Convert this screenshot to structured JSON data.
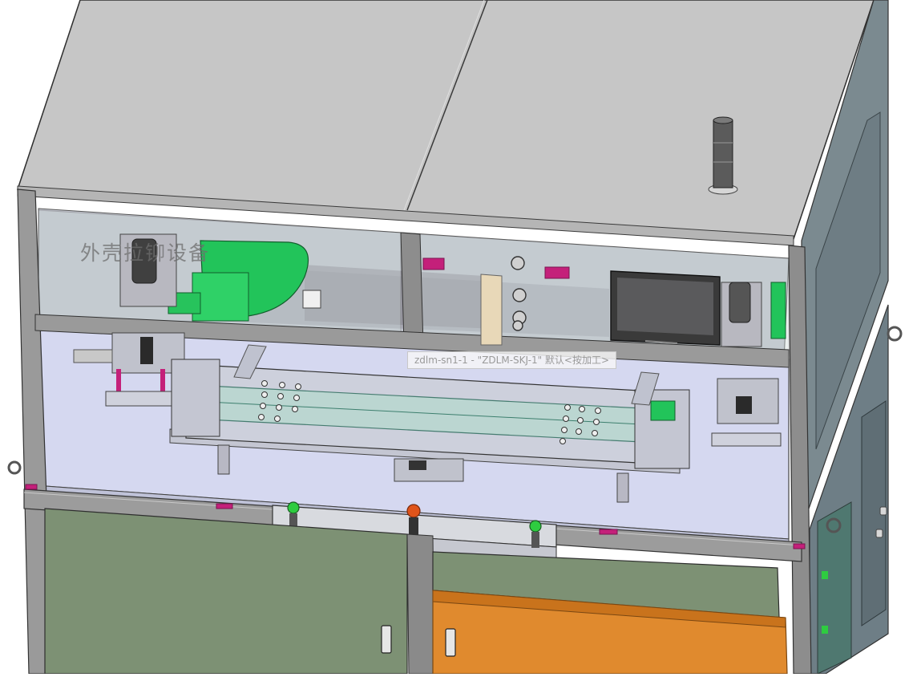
{
  "model": {
    "title_label": "外壳拉铆设备",
    "tooltip_text": "zdlm-sn1-1 - \"ZDLM-SKJ-1\" 默认<按加工>"
  },
  "colors": {
    "background": "#ffffff",
    "roof": "#c4c4c4",
    "frame": "#8a8a8a",
    "table": "#d5d8f0",
    "guard_glass": "#b8d8d0",
    "green_part": "#22c45a",
    "lower_door": "#7d9174",
    "orange_drawer": "#e08a2e",
    "magenta_block": "#c4207a",
    "side_panel": "#6e7e86",
    "stop_button": "#e0541a",
    "start_button": "#2ecc40"
  },
  "icons": {
    "stack_light": "signal-tower-icon",
    "emergency_stop": "emergency-stop-icon",
    "start_button": "start-button-icon",
    "monitor": "hmi-display-icon",
    "lifting_eye": "lifting-eye-icon"
  }
}
